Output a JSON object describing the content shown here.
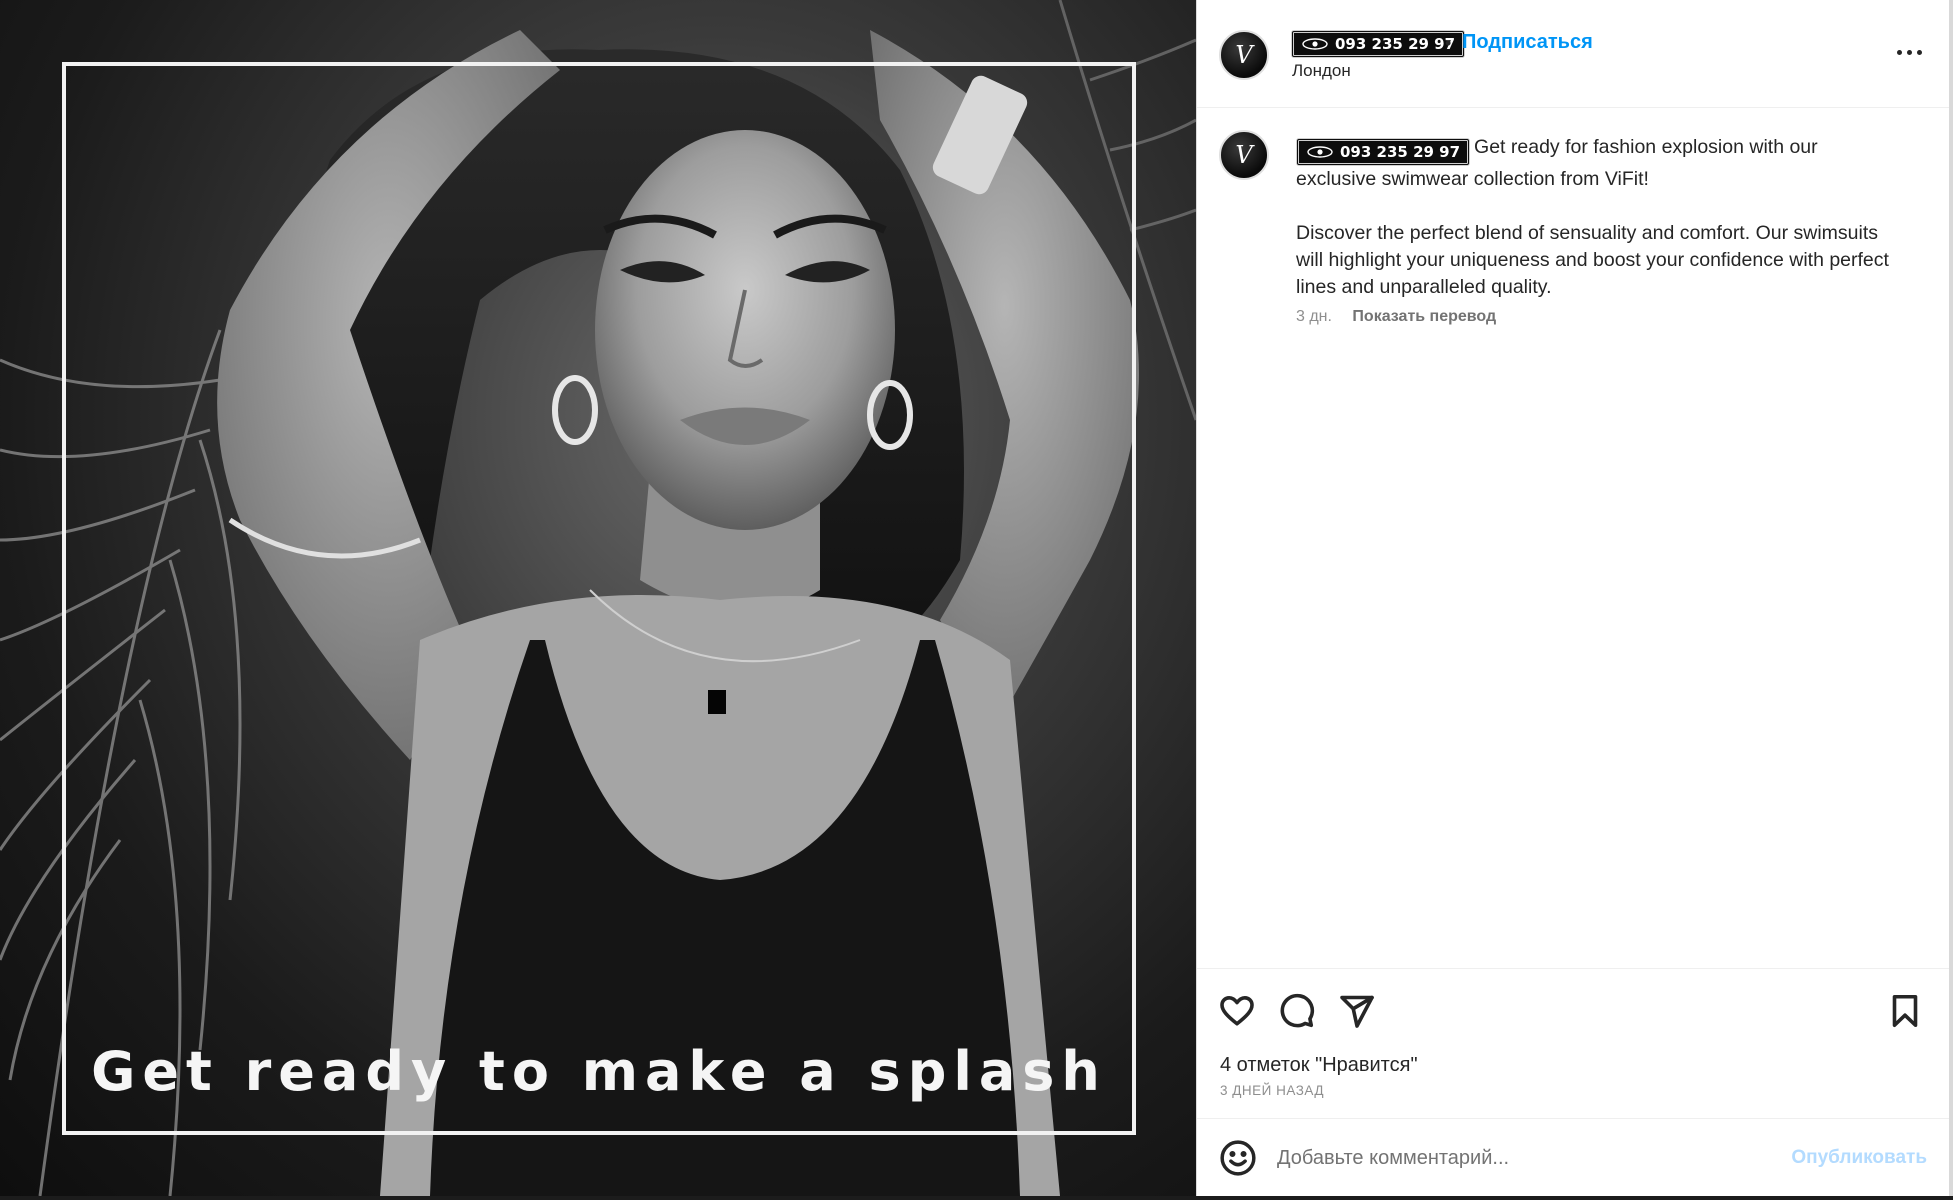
{
  "post": {
    "media": {
      "overlay_text": "Get ready to make a splash"
    },
    "author": {
      "avatar_monogram": "V",
      "phone": "093 235 29 97",
      "follow_label": "Подписаться",
      "separator": "•",
      "location": "Лондон"
    },
    "caption": {
      "paragraph1": "Get ready for fashion explosion with our exclusive swimwear collection from ViFit!",
      "paragraph2": "Discover the perfect blend of sensuality and comfort. Our swimsuits will highlight your uniqueness and boost your confidence with perfect lines and unparalleled quality.",
      "age": "3 дн.",
      "translate_label": "Показать перевод"
    },
    "actions": {
      "likes_text": "4 отметок \"Нравится\"",
      "posted_ago": "3 ДНЕЙ НАЗАД",
      "icons": [
        "heart-icon",
        "comment-bubble-icon",
        "send-icon",
        "bookmark-icon"
      ]
    },
    "comment_box": {
      "placeholder": "Добавьте комментарий...",
      "value": "",
      "publish_label": "Опубликовать"
    }
  },
  "colors": {
    "accent": "#0095f6",
    "publish_disabled": "#b3dbff",
    "text": "#262626",
    "muted": "#8e8e8e"
  }
}
